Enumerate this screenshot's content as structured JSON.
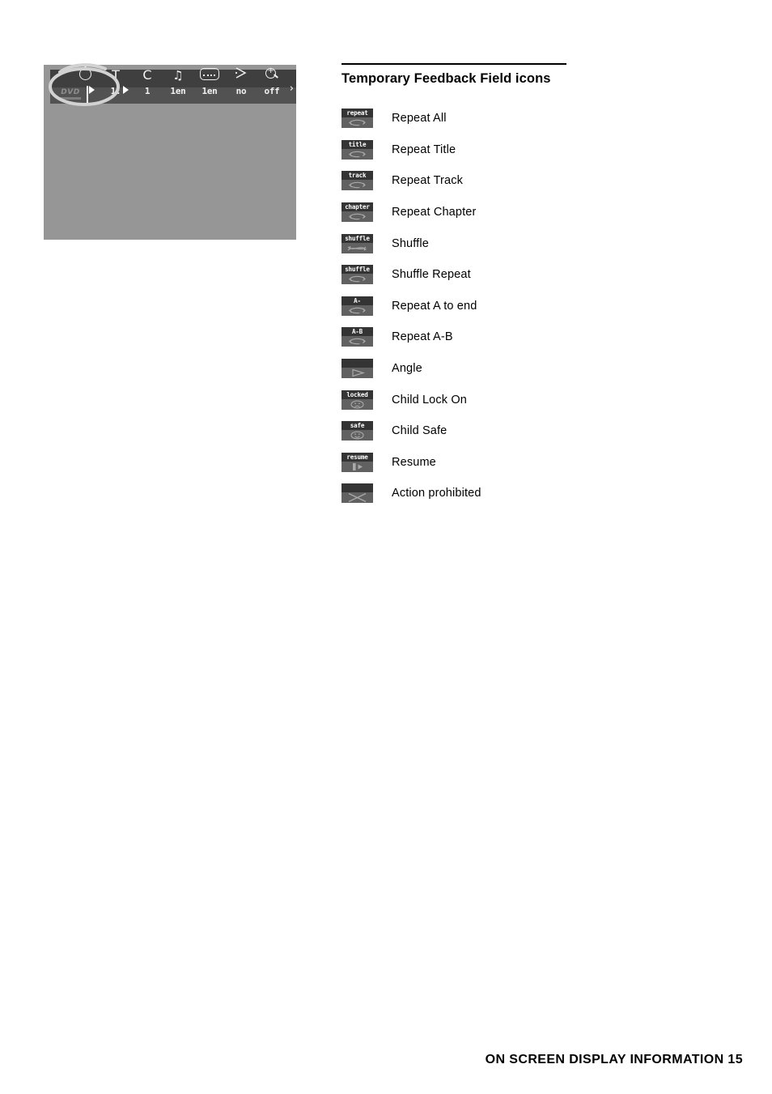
{
  "section": {
    "title": "Temporary Feedback Field icons"
  },
  "osd": {
    "logo": "DVD",
    "end_arrow": "›",
    "cells": [
      {
        "name": "disc-time",
        "glyph": "disc-icon",
        "value": ""
      },
      {
        "name": "title",
        "glyph": "T",
        "value": "1:"
      },
      {
        "name": "chapter",
        "glyph": "C",
        "value": "1"
      },
      {
        "name": "audio-language",
        "glyph": "audio-icon",
        "value": "1en"
      },
      {
        "name": "subtitle-language",
        "glyph": "subtitle-icon",
        "value": "1en"
      },
      {
        "name": "camera-angle",
        "glyph": "angle-icon",
        "value": "no"
      },
      {
        "name": "zoom",
        "glyph": "magnifier-icon",
        "value": "off"
      }
    ]
  },
  "icons": [
    {
      "badge": "repeat",
      "glyph": "loop",
      "label": "Repeat All"
    },
    {
      "badge": "title",
      "glyph": "loop",
      "label": "Repeat Title"
    },
    {
      "badge": "track",
      "glyph": "loop",
      "label": "Repeat Track"
    },
    {
      "badge": "chapter",
      "glyph": "loop",
      "label": "Repeat Chapter"
    },
    {
      "badge": "shuffle",
      "glyph": "shuffle",
      "label": "Shuffle"
    },
    {
      "badge": "shuffle",
      "glyph": "loop",
      "label": "Shuffle Repeat"
    },
    {
      "badge": "A-",
      "glyph": "loop",
      "label": "Repeat A to end"
    },
    {
      "badge": "A-B",
      "glyph": "loop",
      "label": "Repeat A-B"
    },
    {
      "badge": "",
      "glyph": "play",
      "label": "Angle"
    },
    {
      "badge": "locked",
      "glyph": "sadface",
      "label": "Child Lock On"
    },
    {
      "badge": "safe",
      "glyph": "smiley",
      "label": "Child Safe"
    },
    {
      "badge": "resume",
      "glyph": "resume",
      "label": "Resume"
    },
    {
      "badge": "",
      "glyph": "cross",
      "label": "Action prohibited"
    }
  ],
  "footer": {
    "text": "ON SCREEN DISPLAY INFORMATION 15"
  },
  "colors": {
    "screen_bg": "#969696",
    "bar_top": "#3f3f3f",
    "bar_bottom": "#525252",
    "icon_top": "#343434",
    "icon_bottom": "#616161",
    "annotation": "#d2d2d2"
  }
}
